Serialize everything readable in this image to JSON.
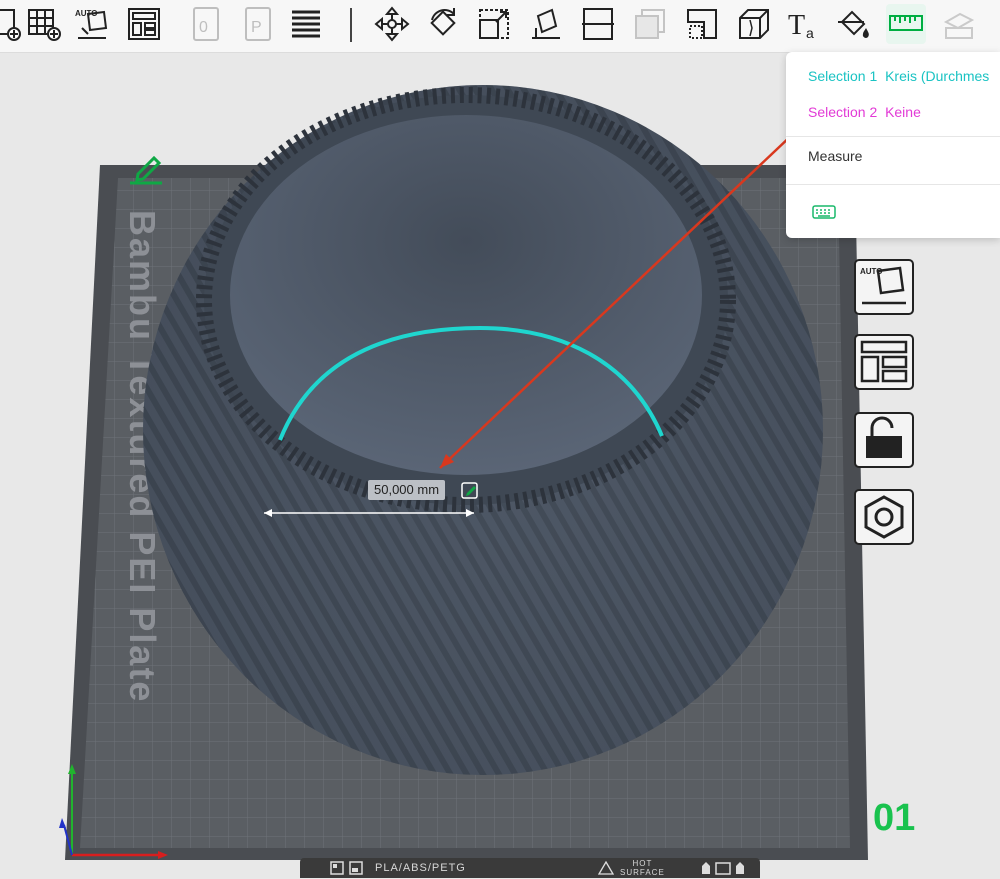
{
  "toolbar": {
    "items": [
      {
        "name": "add-plate-icon",
        "state": "enabled"
      },
      {
        "name": "auto-orient-icon",
        "state": "enabled"
      },
      {
        "name": "arrange-icon",
        "state": "enabled"
      },
      {
        "name": "plate-settings-icon",
        "state": "disabled"
      },
      {
        "name": "plate-print-icon",
        "state": "disabled"
      },
      {
        "name": "layers-icon",
        "state": "enabled"
      },
      {
        "name": "move-icon",
        "state": "enabled"
      },
      {
        "name": "rotate-icon",
        "state": "enabled"
      },
      {
        "name": "scale-icon",
        "state": "enabled"
      },
      {
        "name": "lay-on-face-icon",
        "state": "enabled"
      },
      {
        "name": "cut-icon",
        "state": "enabled"
      },
      {
        "name": "support-paint-icon",
        "state": "disabled"
      },
      {
        "name": "seam-paint-icon",
        "state": "enabled"
      },
      {
        "name": "mesh-boolean-icon",
        "state": "enabled"
      },
      {
        "name": "text-tool-icon",
        "state": "enabled"
      },
      {
        "name": "color-paint-icon",
        "state": "enabled"
      },
      {
        "name": "measure-ruler-icon",
        "state": "active"
      },
      {
        "name": "assembly-icon",
        "state": "disabled"
      }
    ],
    "accent": "#00ae42"
  },
  "measure_panel": {
    "selection1_label": "Selection 1",
    "selection1_value": "Kreis (Durchmes",
    "selection2_label": "Selection 2",
    "selection2_value": "Keine",
    "title": "Measure",
    "keyboard_icon": "keyboard-icon",
    "selection1_color": "#1ac3c3",
    "selection2_color": "#e23ad6"
  },
  "side_toolbar": {
    "items": [
      {
        "name": "auto-orient-side-icon"
      },
      {
        "name": "arrange-side-icon"
      },
      {
        "name": "lock-icon"
      },
      {
        "name": "hex-nut-icon"
      }
    ]
  },
  "viewport": {
    "dimension_label": "50,000 mm",
    "plate_text": "Bambu Textured PEI Plate",
    "plate_number": "01",
    "filament_text": "PLA/ABS/PETG",
    "hot_surface_line1": "HOT",
    "hot_surface_line2": "SURFACE",
    "selection_circle_color": "#1fd6cf",
    "annotation_arrow_color": "#d9381e"
  }
}
